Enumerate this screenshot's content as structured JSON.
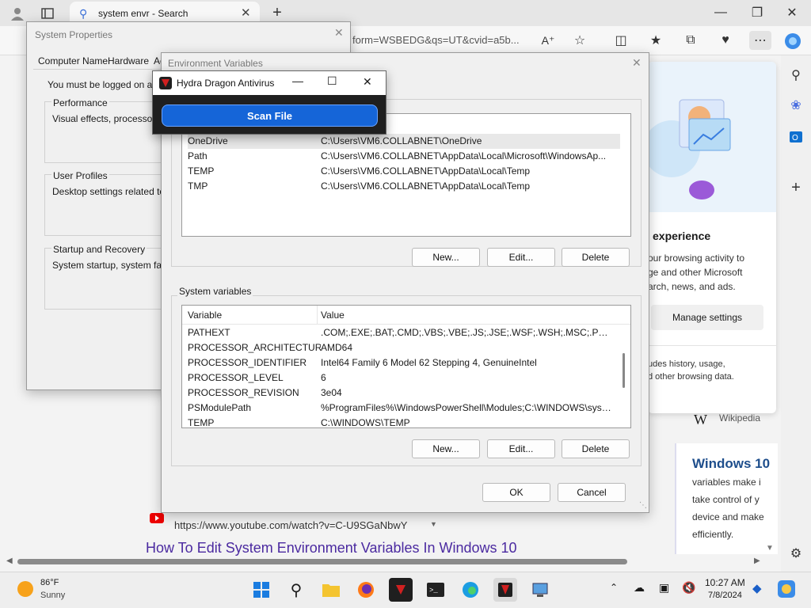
{
  "browser": {
    "tab_title": "system envr - Search",
    "address_fragment": "form=WSBEDG&qs=UT&cvid=a5b...",
    "side_card": {
      "heading": "experience",
      "text_lines": [
        "our browsing activity to",
        "ge and other Microsoft",
        "arch, news, and ads."
      ],
      "manage_button": "Manage settings",
      "note_lines": [
        "udes history, usage,",
        "d other browsing data."
      ]
    },
    "wikipedia_label": "Wikipedia",
    "right_card": {
      "title": "Windows 10",
      "lines": [
        "variables make i",
        "take control of y",
        "device and make",
        "efficiently."
      ]
    },
    "result_url": "https://www.youtube.com/watch?v=C-U9SGaNbwY",
    "result_title": "How To Edit System Environment Variables In Windows 10"
  },
  "system_properties": {
    "title": "System Properties",
    "tabs": [
      "Computer Name",
      "Hardware",
      "Ac"
    ],
    "logon_note": "You must be logged on as a",
    "performance": {
      "label": "Performance",
      "text": "Visual effects, processor sc"
    },
    "user_profiles": {
      "label": "User Profiles",
      "text": "Desktop settings related to yo"
    },
    "startup": {
      "label": "Startup and Recovery",
      "text": "System startup, system failure"
    }
  },
  "env_vars": {
    "title": "Environment Variables",
    "user_rows": [
      {
        "name": "OneDrive",
        "value": "C:\\Users\\VM6.COLLABNET\\OneDrive"
      },
      {
        "name": "Path",
        "value": "C:\\Users\\VM6.COLLABNET\\AppData\\Local\\Microsoft\\WindowsAp..."
      },
      {
        "name": "TEMP",
        "value": "C:\\Users\\VM6.COLLABNET\\AppData\\Local\\Temp"
      },
      {
        "name": "TMP",
        "value": "C:\\Users\\VM6.COLLABNET\\AppData\\Local\\Temp"
      }
    ],
    "user_buttons": {
      "new": "New...",
      "edit": "Edit...",
      "delete": "Delete"
    },
    "system_label": "System variables",
    "headers": {
      "variable": "Variable",
      "value": "Value"
    },
    "system_rows": [
      {
        "name": "PATHEXT",
        "value": ".COM;.EXE;.BAT;.CMD;.VBS;.VBE;.JS;.JSE;.WSF;.WSH;.MSC;.PY;.PYW"
      },
      {
        "name": "PROCESSOR_ARCHITECTURE",
        "value": "AMD64"
      },
      {
        "name": "PROCESSOR_IDENTIFIER",
        "value": "Intel64 Family 6 Model 62 Stepping 4, GenuineIntel"
      },
      {
        "name": "PROCESSOR_LEVEL",
        "value": "6"
      },
      {
        "name": "PROCESSOR_REVISION",
        "value": "3e04"
      },
      {
        "name": "PSModulePath",
        "value": "%ProgramFiles%\\WindowsPowerShell\\Modules;C:\\WINDOWS\\syst..."
      },
      {
        "name": "TEMP",
        "value": "C:\\WINDOWS\\TEMP"
      }
    ],
    "system_buttons": {
      "new": "New...",
      "edit": "Edit...",
      "delete": "Delete"
    },
    "ok": "OK",
    "cancel": "Cancel"
  },
  "hydra": {
    "title": "Hydra Dragon Antivirus",
    "scan_button": "Scan File"
  },
  "taskbar": {
    "weather_temp": "86°F",
    "weather_desc": "Sunny",
    "time": "10:27 AM",
    "date": "7/8/2024"
  },
  "colors": {
    "scan_button": "#1565d8",
    "hydra_bg": "#1f1f1f",
    "link": "#4b2aa0",
    "selected_row": "#e8e8e8"
  }
}
